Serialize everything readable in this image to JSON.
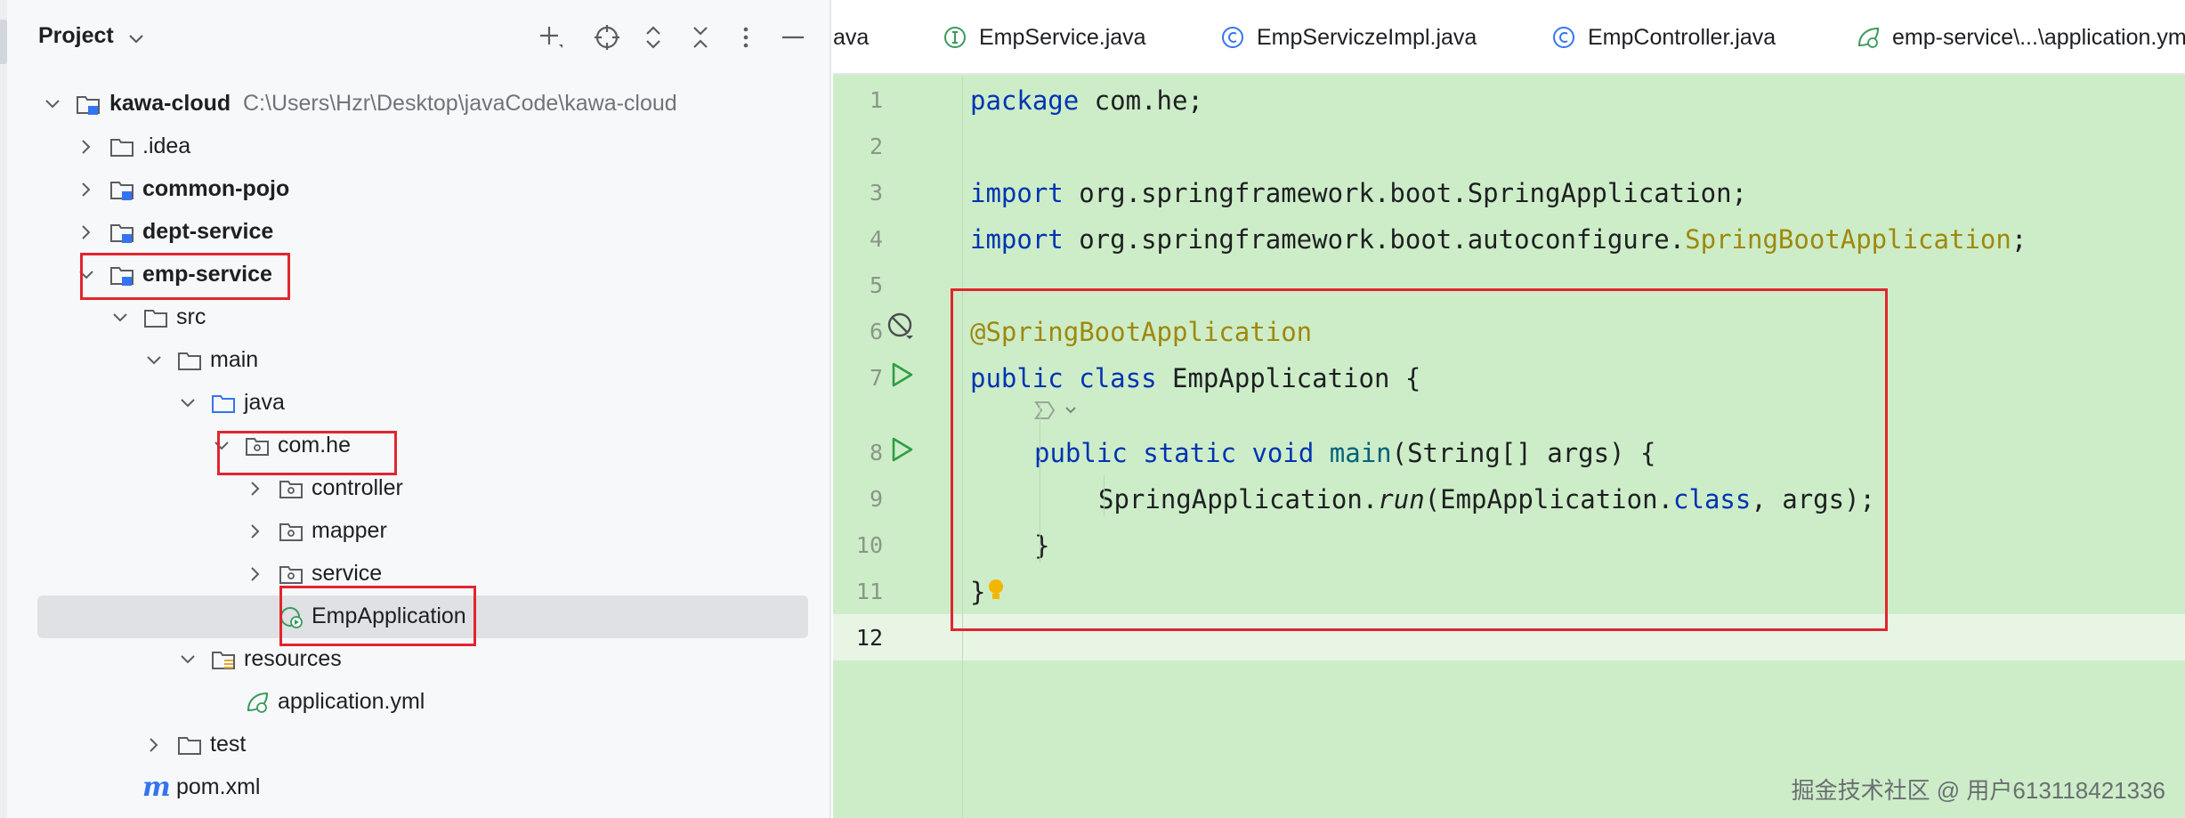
{
  "panel": {
    "title": "Project",
    "icons": [
      "add-icon",
      "locate-icon",
      "expand-all-icon",
      "collapse-all-icon",
      "more-icon",
      "minimize-icon"
    ]
  },
  "tree": {
    "root": {
      "label": "kawa-cloud",
      "path": "C:\\Users\\Hzr\\Desktop\\javaCode\\kawa-cloud"
    },
    "idea": ".idea",
    "common_pojo": "common-pojo",
    "dept_service": "dept-service",
    "emp_service": "emp-service",
    "src": "src",
    "main": "main",
    "java": "java",
    "com_he": "com.he",
    "controller": "controller",
    "mapper": "mapper",
    "service": "service",
    "emp_application": "EmpApplication",
    "resources": "resources",
    "application_yml": "application.yml",
    "test": "test",
    "pom": "pom.xml"
  },
  "tabs": [
    {
      "label": "ava"
    },
    {
      "label": "EmpService.java",
      "icon": "interface-icon"
    },
    {
      "label": "EmpServiczeImpl.java",
      "icon": "class-icon"
    },
    {
      "label": "EmpController.java",
      "icon": "class-icon"
    },
    {
      "label": "emp-service\\...\\application.ym",
      "icon": "spring-yml-icon"
    }
  ],
  "line_numbers": [
    "1",
    "2",
    "3",
    "4",
    "5",
    "6",
    "7",
    "8",
    "9",
    "10",
    "11",
    "12"
  ],
  "code": {
    "l1": {
      "kw": "package",
      "rest": " com.he;"
    },
    "l3": {
      "kw": "import",
      "rest": " org.springframework.boot.SpringApplication;"
    },
    "l4": {
      "kw": "import",
      "rest": " org.springframework.boot.autoconfigure.",
      "ann": "SpringBootApplication",
      "end": ";"
    },
    "l6": {
      "ann": "@SpringBootApplication"
    },
    "l7": {
      "kw1": "public",
      "kw2": "class",
      "rest": " EmpApplication {"
    },
    "l8": {
      "kw1": "public",
      "kw2": "static",
      "kw3": "void",
      "fn": "main",
      "rest": "(String[] args) {"
    },
    "l9": {
      "a": "SpringApplication.",
      "it": "run",
      "b": "(EmpApplication.",
      "kw": "class",
      "c": ", args);"
    },
    "l10": "}",
    "l11": "}"
  },
  "watermark": "掘金技术社区 @ 用户613118421336",
  "colors": {
    "keyword": "#0033b3",
    "annotation": "#9e880d",
    "highlight": "#e0262f",
    "editor_bg": "#cdedc8"
  }
}
